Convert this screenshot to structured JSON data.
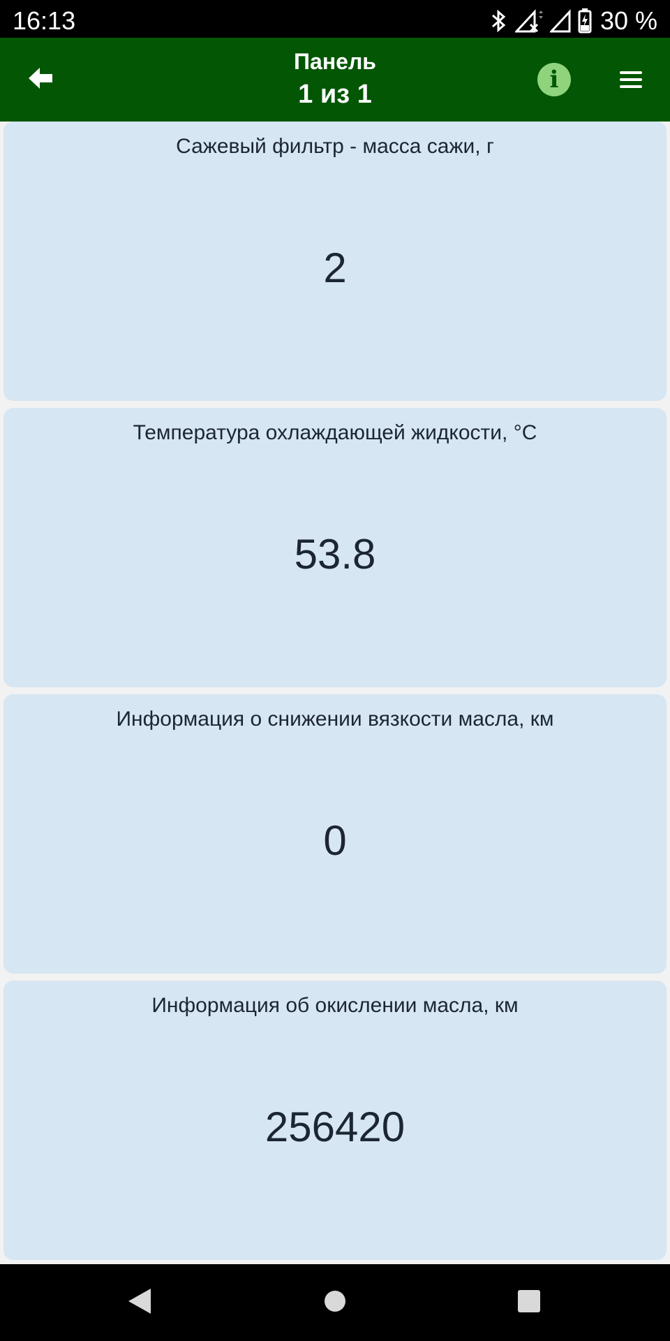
{
  "status_bar": {
    "time": "16:13",
    "battery": "30 %",
    "icons": [
      "bluetooth-icon",
      "signal-no-sim-icon",
      "signal-icon",
      "battery-icon"
    ]
  },
  "app_bar": {
    "title": "Панель",
    "page_indicator": "1 из 1",
    "info_glyph": "i",
    "background_color": "#035603",
    "info_color": "#8fd37d",
    "icons": [
      "back-arrow-icon",
      "info-icon",
      "menu-icon"
    ]
  },
  "cards": [
    {
      "label": "Сажевый фильтр - масса сажи, г",
      "value": "2"
    },
    {
      "label": "Температура охлаждающей жидкости, °C",
      "value": "53.8"
    },
    {
      "label": "Информация о снижении вязкости масла, км",
      "value": "0"
    },
    {
      "label": "Информация об окислении масла, км",
      "value": "256420"
    }
  ],
  "card_color": "#d6e6f2",
  "nav_bar": {
    "icons": [
      "back-triangle-icon",
      "home-circle-icon",
      "recents-square-icon"
    ]
  }
}
